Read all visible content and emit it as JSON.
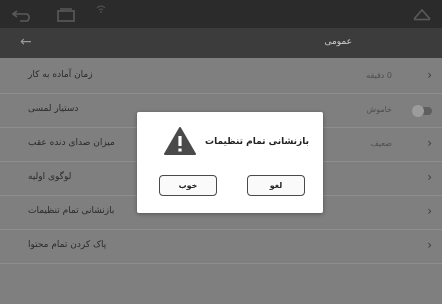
{
  "status_bar": {
    "icons": [
      "back-icon",
      "recent-apps-icon",
      "wifi-icon",
      "home-icon"
    ]
  },
  "title_bar": {
    "title": "عمومی",
    "back_icon": "arrow-left-icon"
  },
  "settings": {
    "items": [
      {
        "label": "زمان آماده به کار",
        "value": "0 دقیقه",
        "control": "chevron"
      },
      {
        "label": "دستیار لمسی",
        "value": "خاموش",
        "control": "toggle"
      },
      {
        "label": "میزان صدای دنده عقب",
        "value": "ضعیف",
        "control": "chevron"
      },
      {
        "label": "لوگوی اولیه",
        "value": "",
        "control": "chevron"
      },
      {
        "label": "بازنشانی تمام تنظیمات",
        "value": "",
        "control": "chevron"
      },
      {
        "label": "پاک کردن تمام محتوا",
        "value": "",
        "control": "chevron"
      }
    ]
  },
  "dialog": {
    "message": "بازنشانی تمام تنظیمات",
    "icon": "warning-icon",
    "ok_label": "خوب",
    "cancel_label": "لغو"
  },
  "colors": {
    "status_bar_bg": "#2b2b2b",
    "title_bar_bg": "#3c3c3c",
    "overlay_bg": "#7f7f7f",
    "dialog_bg": "#ffffff"
  }
}
